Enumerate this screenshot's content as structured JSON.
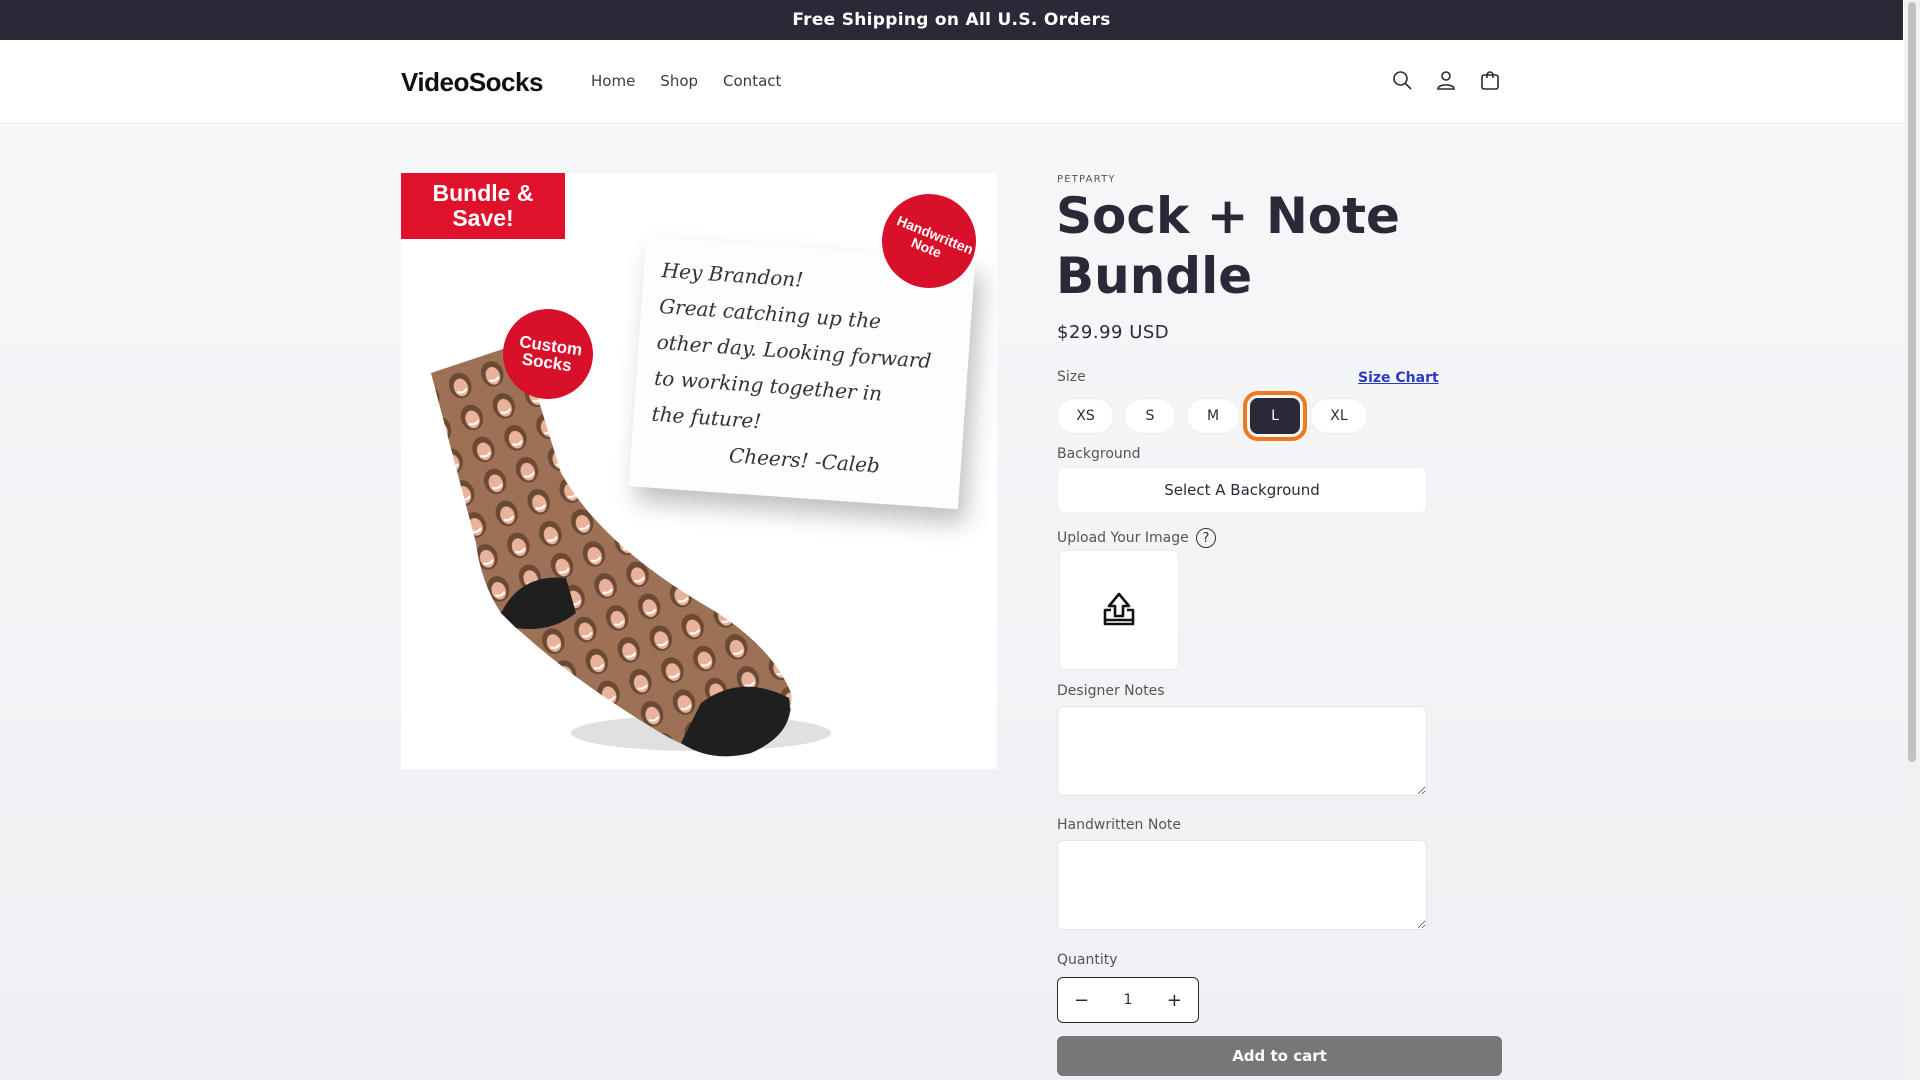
{
  "announcement": "Free Shipping on All U.S. Orders",
  "header": {
    "logo": "VideoSocks",
    "nav": [
      "Home",
      "Shop",
      "Contact"
    ],
    "icons": [
      "search-icon",
      "account-icon",
      "cart-icon"
    ]
  },
  "media": {
    "bundle_badge": "Bundle & Save!",
    "custom_socks_badge": "Custom Socks",
    "handwritten_badge": "Handwritten Note",
    "note_lines": [
      "Hey Brandon!",
      "Great catching up the",
      "other day. Looking forward",
      "to working together in",
      "the future!",
      "Cheers! -Caleb"
    ]
  },
  "product": {
    "vendor": "PETPARTY",
    "title": "Sock + Note Bundle",
    "price": "$29.99 USD",
    "size_label": "Size",
    "size_chart": "Size Chart",
    "sizes": [
      "XS",
      "S",
      "M",
      "L",
      "XL"
    ],
    "selected_size": "L",
    "background_label": "Background",
    "background_button": "Select A Background",
    "upload_label": "Upload Your Image",
    "help": "?",
    "designer_notes_label": "Designer Notes",
    "designer_notes_value": "",
    "handwritten_note_label": "Handwritten Note",
    "handwritten_note_value": "",
    "quantity_label": "Quantity",
    "quantity": "1",
    "minus": "−",
    "plus": "+",
    "add_to_cart": "Add to cart"
  },
  "colors": {
    "dark": "#2b2938",
    "accent_red": "#e0112b",
    "focus_outline": "#f0791f",
    "button_gray": "#777777"
  }
}
